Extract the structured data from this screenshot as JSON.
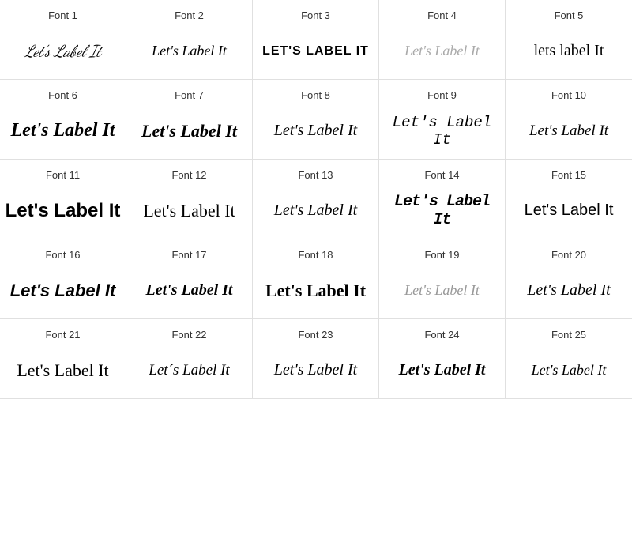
{
  "fonts": [
    {
      "id": 1,
      "label": "Font 1",
      "text": "Let's Label It",
      "class": "f1"
    },
    {
      "id": 2,
      "label": "Font 2",
      "text": "Let's Label It",
      "class": "f2"
    },
    {
      "id": 3,
      "label": "Font 3",
      "text": "LET'S LABEL IT",
      "class": "f3"
    },
    {
      "id": 4,
      "label": "Font 4",
      "text": "Let's Label It",
      "class": "f4"
    },
    {
      "id": 5,
      "label": "Font 5",
      "text": "lets label It",
      "class": "f5"
    },
    {
      "id": 6,
      "label": "Font 6",
      "text": "Let's Label It",
      "class": "f6"
    },
    {
      "id": 7,
      "label": "Font 7",
      "text": "Let's Label It",
      "class": "f7"
    },
    {
      "id": 8,
      "label": "Font 8",
      "text": "Let's Label It",
      "class": "f8"
    },
    {
      "id": 9,
      "label": "Font 9",
      "text": "Let's Label It",
      "class": "f9"
    },
    {
      "id": 10,
      "label": "Font 10",
      "text": "Let's Label It",
      "class": "f10"
    },
    {
      "id": 11,
      "label": "Font 11",
      "text": "Let's Label It",
      "class": "f11"
    },
    {
      "id": 12,
      "label": "Font 12",
      "text": "Let's Label It",
      "class": "f12"
    },
    {
      "id": 13,
      "label": "Font 13",
      "text": "Let's Label It",
      "class": "f13"
    },
    {
      "id": 14,
      "label": "Font 14",
      "text": "Let's Label It",
      "class": "f14"
    },
    {
      "id": 15,
      "label": "Font 15",
      "text": "Let's Label It",
      "class": "f15"
    },
    {
      "id": 16,
      "label": "Font 16",
      "text": "Let's Label It",
      "class": "f16"
    },
    {
      "id": 17,
      "label": "Font 17",
      "text": "Let's Label It",
      "class": "f17"
    },
    {
      "id": 18,
      "label": "Font 18",
      "text": "Let's Label It",
      "class": "f18"
    },
    {
      "id": 19,
      "label": "Font 19",
      "text": "Let's Label It",
      "class": "f19"
    },
    {
      "id": 20,
      "label": "Font 20",
      "text": "Let's Label It",
      "class": "f20"
    },
    {
      "id": 21,
      "label": "Font 21",
      "text": "Let's Label It",
      "class": "f21"
    },
    {
      "id": 22,
      "label": "Font 22",
      "text": "Let´s Label It",
      "class": "f22"
    },
    {
      "id": 23,
      "label": "Font 23",
      "text": "Let's Label It",
      "class": "f23"
    },
    {
      "id": 24,
      "label": "Font 24",
      "text": "Let's Label It",
      "class": "f24"
    },
    {
      "id": 25,
      "label": "Font 25",
      "text": "Let's Label It",
      "class": "f25"
    }
  ]
}
